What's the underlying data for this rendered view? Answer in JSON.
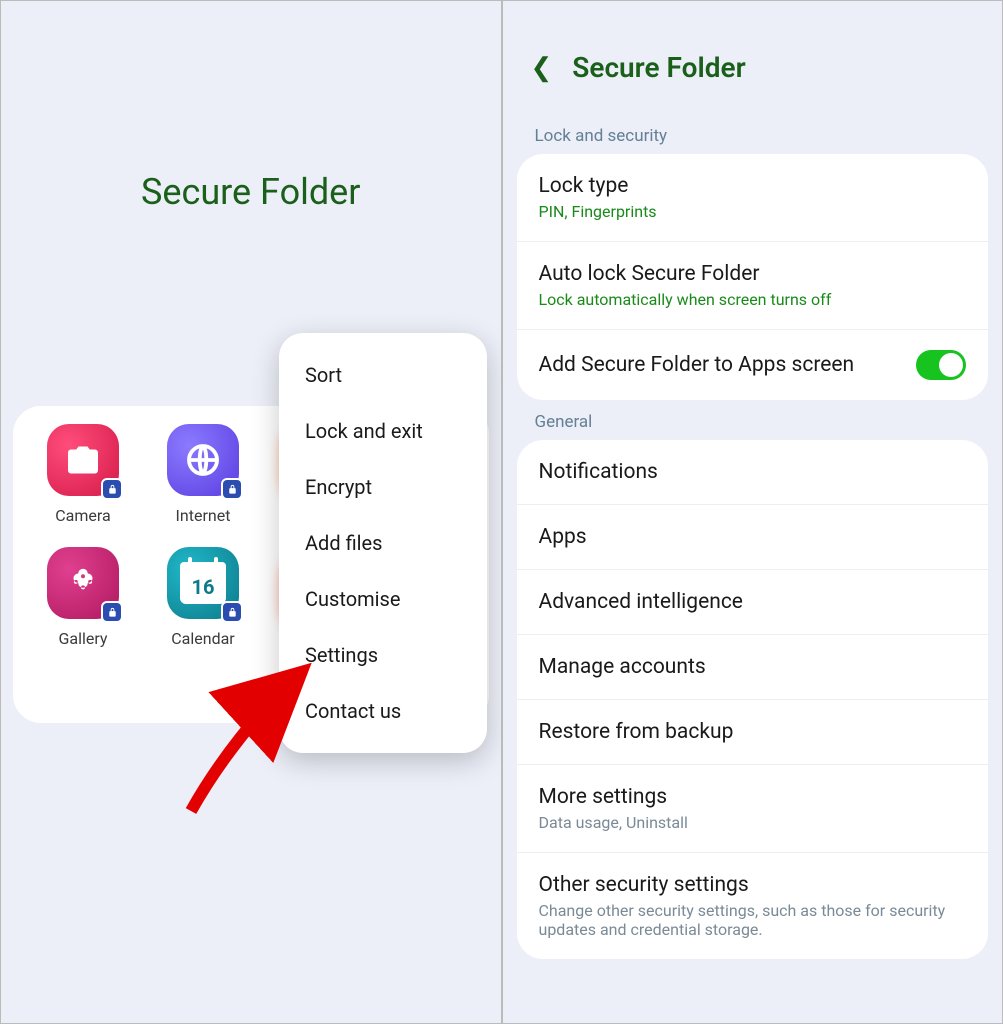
{
  "left": {
    "title": "Secure Folder",
    "apps": [
      {
        "name": "Camera",
        "icon": "camera-icon"
      },
      {
        "name": "Internet",
        "icon": "internet-icon"
      },
      {
        "name": "Gallery",
        "icon": "gallery-icon"
      },
      {
        "name": "Calendar",
        "icon": "calendar-icon",
        "day": "16"
      }
    ],
    "menu": [
      "Sort",
      "Lock and exit",
      "Encrypt",
      "Add files",
      "Customise",
      "Settings",
      "Contact us"
    ]
  },
  "right": {
    "title": "Secure Folder",
    "sections": [
      {
        "label": "Lock and security",
        "rows": [
          {
            "title": "Lock type",
            "sub": "PIN, Fingerprints",
            "subStyle": "green"
          },
          {
            "title": "Auto lock Secure Folder",
            "sub": "Lock automatically when screen turns off",
            "subStyle": "green"
          },
          {
            "title": "Add Secure Folder to Apps screen",
            "toggle": true
          }
        ]
      },
      {
        "label": "General",
        "rows": [
          {
            "title": "Notifications"
          },
          {
            "title": "Apps"
          },
          {
            "title": "Advanced intelligence"
          },
          {
            "title": "Manage accounts"
          },
          {
            "title": "Restore from backup"
          },
          {
            "title": "More settings",
            "sub": "Data usage, Uninstall",
            "subStyle": "gray"
          },
          {
            "title": "Other security settings",
            "sub": "Change other security settings, such as those for security updates and credential storage.",
            "subStyle": "gray"
          }
        ]
      }
    ]
  }
}
